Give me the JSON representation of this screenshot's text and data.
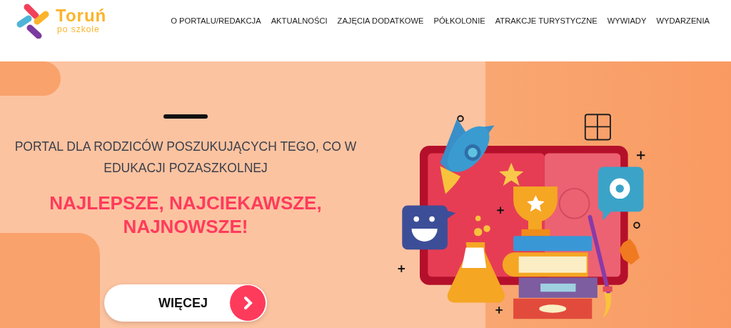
{
  "logo": {
    "title": "Toruń",
    "subtitle": "po szkole"
  },
  "nav": [
    {
      "label": "O PORTALU/REDAKCJA"
    },
    {
      "label": "AKTUALNOŚCI"
    },
    {
      "label": "ZAJĘCIA DODATKOWE"
    },
    {
      "label": "PÓŁKOLONIE"
    },
    {
      "label": "ATRAKCJE TURYSTYCZNE"
    },
    {
      "label": "WYWIADY"
    },
    {
      "label": "WYDARZENIA"
    }
  ],
  "hero": {
    "tagline": "PORTAL DLA RODZICÓW POSZUKUJĄCYCH TEGO, CO W EDUKACJI POZASZKOLNEJ",
    "headline": "NAJLEPSZE, NAJCIEKAWSZE, NAJNOWSZE!",
    "button": "WIĘCEJ"
  }
}
